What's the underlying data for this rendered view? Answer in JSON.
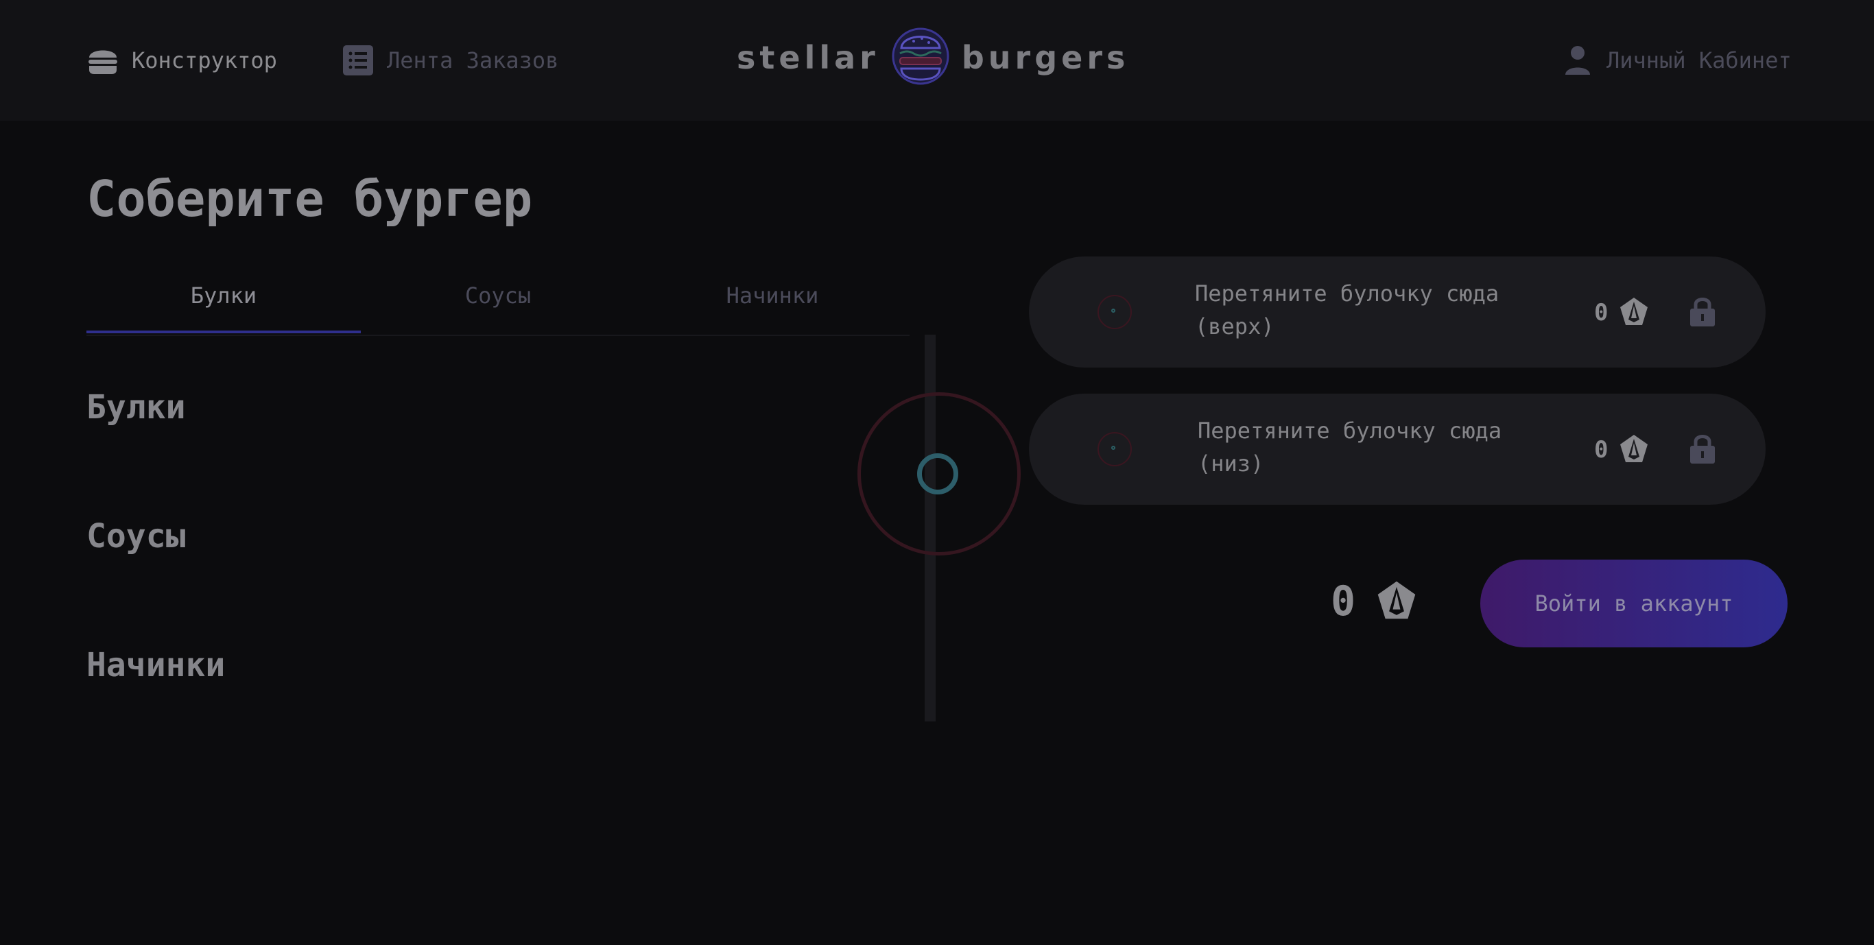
{
  "header": {
    "nav": {
      "constructor": "Конструктор",
      "feed": "Лента Заказов",
      "profile": "Личный Кабинет"
    },
    "logo": {
      "left": "stellar",
      "right": "burgers"
    }
  },
  "main": {
    "title": "Соберите бургер",
    "tabs": [
      {
        "label": "Булки",
        "active": true
      },
      {
        "label": "Соусы",
        "active": false
      },
      {
        "label": "Начинки",
        "active": false
      }
    ],
    "sections": [
      "Булки",
      "Соусы",
      "Начинки"
    ]
  },
  "constructor": {
    "top_bun": {
      "text": "Перетяните булочку сюда (верх)",
      "price": "0"
    },
    "bottom_bun": {
      "text": "Перетяните булочку сюда (низ)",
      "price": "0"
    },
    "total": "0",
    "login_button": "Войти в аккаунт"
  },
  "icons": {
    "burger": "burger-icon",
    "list": "list-icon",
    "profile": "profile-icon",
    "currency": "currency-icon",
    "lock": "lock-icon"
  },
  "colors": {
    "background": "#0c0c0e",
    "header": "#121215",
    "tab_active": "#2f2f8c",
    "button_gradient_start": "#3f1a69",
    "button_gradient_end": "#2e2b8e"
  }
}
